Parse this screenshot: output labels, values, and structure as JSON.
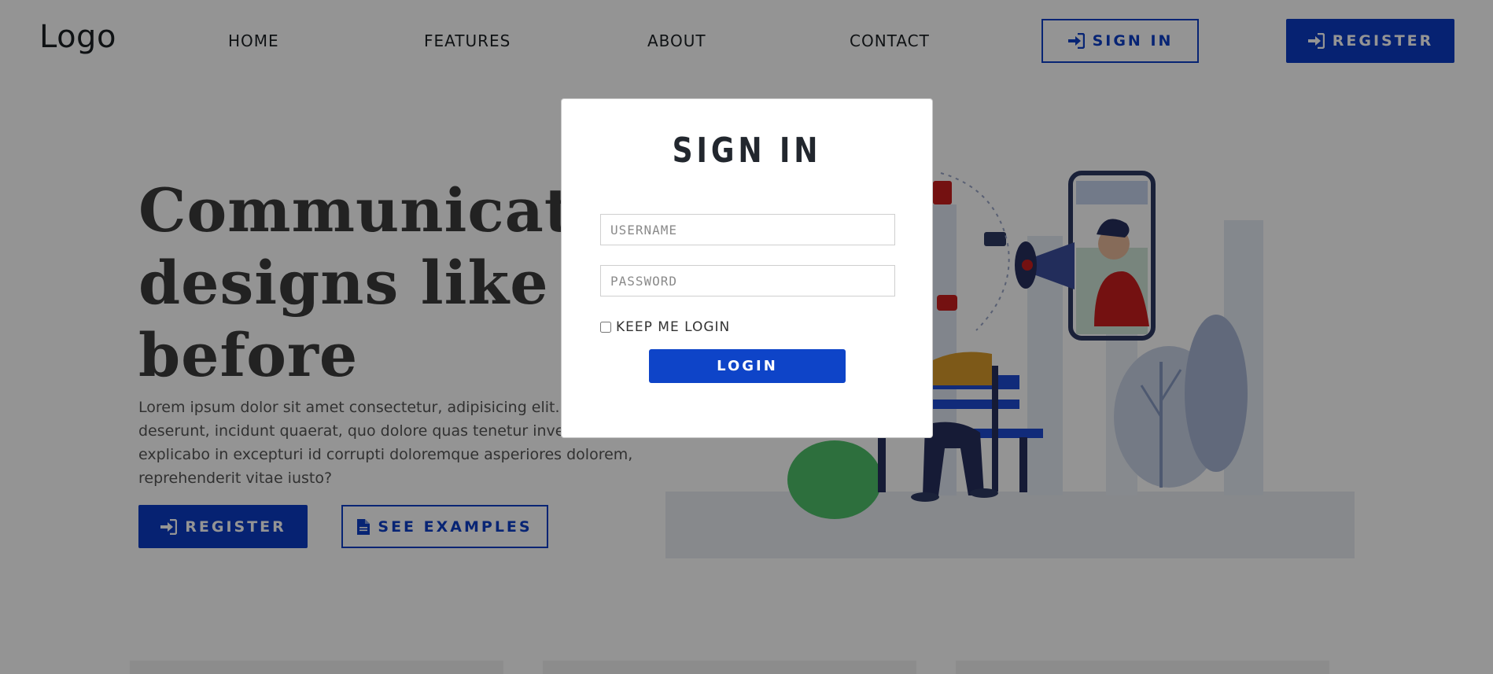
{
  "navbar": {
    "logo": "Logo",
    "links": [
      "HOME",
      "FEATURES",
      "ABOUT",
      "CONTACT"
    ],
    "signin_label": "SIGN IN",
    "register_label": "REGISTER"
  },
  "hero": {
    "title": "Communicate your\ndesigns like never\nbefore",
    "text": "Lorem ipsum dolor sit amet consectetur, adipisicing elit. Commodi deserunt, incidunt quaerat, quo dolore quas tenetur inventore explicabo in excepturi id corrupti doloremque asperiores dolorem, reprehenderit vitae iusto?",
    "register_label": "REGISTER",
    "examples_label": "SEE EXAMPLES"
  },
  "modal": {
    "title": "SIGN IN",
    "username_placeholder": "USERNAME",
    "password_placeholder": "PASSWORD",
    "keep_login_label": "KEEP ME LOGIN",
    "login_label": "LOGIN"
  },
  "colors": {
    "brand": "#0b3bc4",
    "overlay": "rgba(0,0,0,0.42)"
  },
  "icons": {
    "signin": "sign-in-icon",
    "document": "file-icon"
  }
}
